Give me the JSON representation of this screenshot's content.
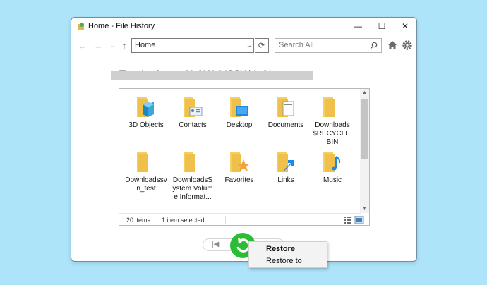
{
  "window": {
    "title": "Home - File History",
    "controls": {
      "minimize": "—",
      "maximize": "☐",
      "close": "✕"
    }
  },
  "toolbar": {
    "address_value": "Home",
    "search_placeholder": "Search All"
  },
  "date_caption": "Thursday, January 21, 2021 3:07 PM  |  1 of 1",
  "items": [
    {
      "label": "3D Objects",
      "icon": "folder-3d-icon"
    },
    {
      "label": "Contacts",
      "icon": "folder-contacts-icon"
    },
    {
      "label": "Desktop",
      "icon": "folder-desktop-icon"
    },
    {
      "label": "Documents",
      "icon": "folder-documents-icon"
    },
    {
      "label": "Downloads$RECYCLE.BIN",
      "icon": "folder-icon"
    },
    {
      "label": "Downloadssvn_test",
      "icon": "folder-icon"
    },
    {
      "label": "DownloadsSystem Volume Informat...",
      "icon": "folder-icon"
    },
    {
      "label": "Favorites",
      "icon": "folder-favorites-icon"
    },
    {
      "label": "Links",
      "icon": "folder-links-icon"
    },
    {
      "label": "Music",
      "icon": "folder-music-icon"
    }
  ],
  "status": {
    "count": "20 items",
    "selected": "1 item selected"
  },
  "context_menu": {
    "items": [
      {
        "label": "Restore"
      },
      {
        "label": "Restore to"
      }
    ]
  },
  "colors": {
    "background": "#aee4fa",
    "folder": "#f6cf63",
    "restore_green": "#2bbd33",
    "accent_blue": "#1e88e5"
  }
}
